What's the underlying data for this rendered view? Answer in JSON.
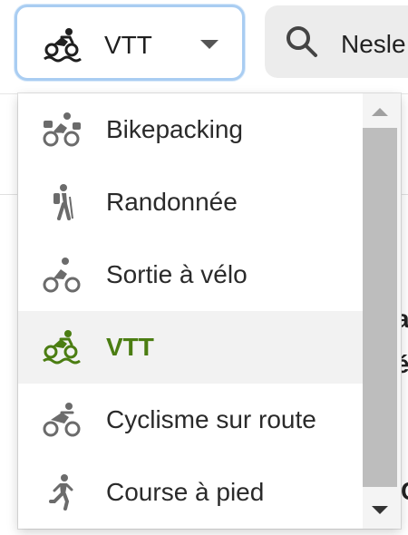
{
  "activity_selector": {
    "selected_label": "VTT",
    "selected_icon": "mountain-bike-icon"
  },
  "search": {
    "value": "Nesle",
    "icon": "search-icon"
  },
  "background": {
    "partial_lines": [
      "a",
      "é",
      "C"
    ]
  },
  "menu": {
    "items": [
      {
        "label": "Bikepacking",
        "icon": "bikepacking-icon",
        "selected": false
      },
      {
        "label": "Randonnée",
        "icon": "hiking-icon",
        "selected": false
      },
      {
        "label": "Sortie à vélo",
        "icon": "bike-ride-icon",
        "selected": false
      },
      {
        "label": "VTT",
        "icon": "mountain-bike-icon",
        "selected": true
      },
      {
        "label": "Cyclisme sur route",
        "icon": "road-cycling-icon",
        "selected": false
      },
      {
        "label": "Course à pied",
        "icon": "running-icon",
        "selected": false
      }
    ]
  },
  "colors": {
    "accent_selected": "#4b7d12",
    "focus_ring": "#a9cdf2",
    "icon_gray": "#6b6b6b",
    "selected_bg": "#f2f2f2"
  }
}
